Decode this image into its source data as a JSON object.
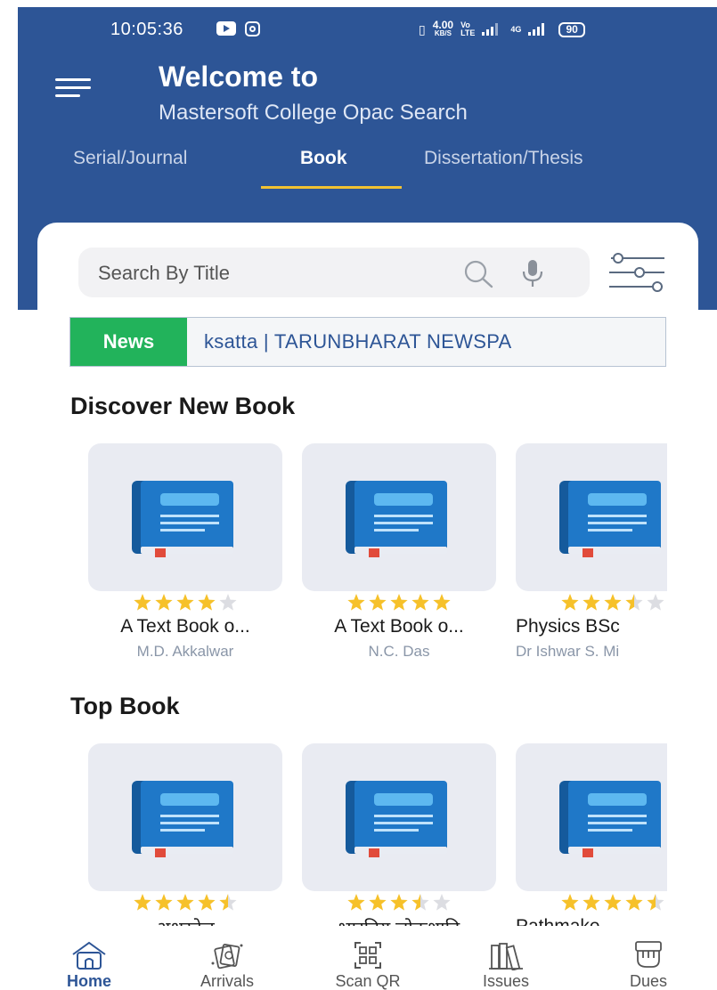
{
  "status_bar": {
    "time": "10:05:36",
    "network_speed": "4.00",
    "network_unit": "KB/S",
    "network_type": "4G",
    "battery": "90"
  },
  "header": {
    "welcome": "Welcome to",
    "college": "Mastersoft College Opac Search"
  },
  "tabs": [
    {
      "label": "Serial/Journal",
      "active": false
    },
    {
      "label": "Book",
      "active": true
    },
    {
      "label": "Dissertation/Thesis",
      "active": false
    }
  ],
  "search": {
    "placeholder": "Search By Title"
  },
  "news": {
    "label": "News",
    "text": "ksatta | TARUNBHARAT NEWSPA"
  },
  "discover": {
    "title": "Discover New Book",
    "books": [
      {
        "title": "A Text Book o...",
        "author": "M.D. Akkalwar",
        "rating": 4
      },
      {
        "title": "A Text Book o...",
        "author": "N.C. Das",
        "rating": 5
      },
      {
        "title": "Physics BSc",
        "author": "Dr Ishwar S. Mi",
        "rating": 3.5
      }
    ]
  },
  "top": {
    "title": "Top Book",
    "books": [
      {
        "title": "अक्षरवेल",
        "author": "",
        "rating": 4.5
      },
      {
        "title": "भारतिय लोकशाहि",
        "author": "",
        "rating": 3.5
      },
      {
        "title": "Pathmake",
        "author": "",
        "rating": 4.5
      }
    ]
  },
  "bottom_nav": [
    {
      "label": "Home",
      "icon": "home-icon",
      "active": true
    },
    {
      "label": "Arrivals",
      "icon": "arrivals-icon",
      "active": false
    },
    {
      "label": "Scan QR",
      "icon": "qr-icon",
      "active": false
    },
    {
      "label": "Issues",
      "icon": "books-icon",
      "active": false
    },
    {
      "label": "Dues",
      "icon": "dues-icon",
      "active": false
    }
  ],
  "colors": {
    "primary": "#2d5596",
    "accent": "#f1c232",
    "news_green": "#22b35b",
    "star": "#f6c12a",
    "book_blue": "#1e6fb5"
  }
}
